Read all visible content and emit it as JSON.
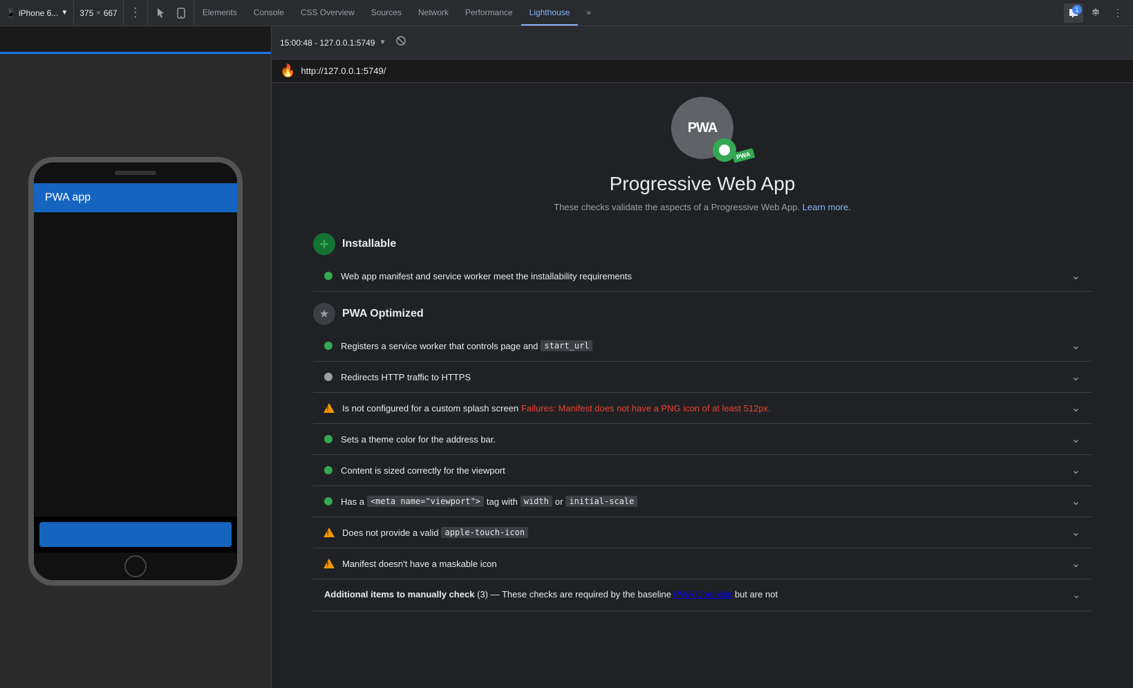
{
  "toolbar": {
    "device": "iPhone 6...",
    "width": "375",
    "height": "667",
    "tabs": [
      {
        "label": "Elements",
        "active": false
      },
      {
        "label": "Console",
        "active": false
      },
      {
        "label": "CSS Overview",
        "active": false
      },
      {
        "label": "Sources",
        "active": false
      },
      {
        "label": "Network",
        "active": false
      },
      {
        "label": "Performance",
        "active": false
      },
      {
        "label": "Lighthouse",
        "active": true
      }
    ],
    "more_tabs": "»",
    "chat_count": "1"
  },
  "url_bar": {
    "time": "15:00:48 - 127.0.0.1:5749",
    "url": "http://127.0.0.1:5749/"
  },
  "phone": {
    "app_title": "PWA app"
  },
  "lighthouse": {
    "page_title": "Progressive Web App",
    "subtitle_text": "These checks validate the aspects of a Progressive Web App.",
    "subtitle_link": "Learn more",
    "pwa_text": "PWA",
    "sections": [
      {
        "id": "installable",
        "icon_type": "plus",
        "title": "Installable",
        "audits": [
          {
            "id": "web-app-manifest",
            "status": "green",
            "text": "Web app manifest and service worker meet the installability requirements",
            "code": null,
            "failure": null
          }
        ]
      },
      {
        "id": "pwa-optimized",
        "icon_type": "star",
        "title": "PWA Optimized",
        "audits": [
          {
            "id": "service-worker",
            "status": "green",
            "text_before": "Registers a service worker that controls page and",
            "code": "start_url",
            "text_after": "",
            "failure": null
          },
          {
            "id": "redirects-http",
            "status": "gray",
            "text_before": "Redirects HTTP traffic to HTTPS",
            "code": null,
            "failure": null
          },
          {
            "id": "splash-screen",
            "status": "warning",
            "text_before": "Is not configured for a custom splash screen",
            "code": null,
            "failure": "Failures: Manifest does not have a PNG icon of at least 512px."
          },
          {
            "id": "theme-color",
            "status": "green",
            "text_before": "Sets a theme color for the address bar.",
            "code": null,
            "failure": null
          },
          {
            "id": "content-width",
            "status": "green",
            "text_before": "Content is sized correctly for the viewport",
            "code": null,
            "failure": null
          },
          {
            "id": "viewport",
            "status": "green",
            "text_before": "Has a",
            "code1": "<meta name=\"viewport\">",
            "text_mid": "tag with",
            "code2": "width",
            "text_mid2": "or",
            "code3": "initial-scale",
            "failure": null
          },
          {
            "id": "apple-touch-icon",
            "status": "warning",
            "text_before": "Does not provide a valid",
            "code": "apple-touch-icon",
            "failure": null
          },
          {
            "id": "maskable-icon",
            "status": "warning",
            "text_before": "Manifest doesn't have a maskable icon",
            "code": null,
            "failure": null
          }
        ]
      }
    ],
    "additional": {
      "label": "Additional items to manually check",
      "count": "3",
      "dash": "—",
      "description": "These checks are required by the baseline",
      "link": "PWA Checklist",
      "description2": "but are not"
    }
  }
}
